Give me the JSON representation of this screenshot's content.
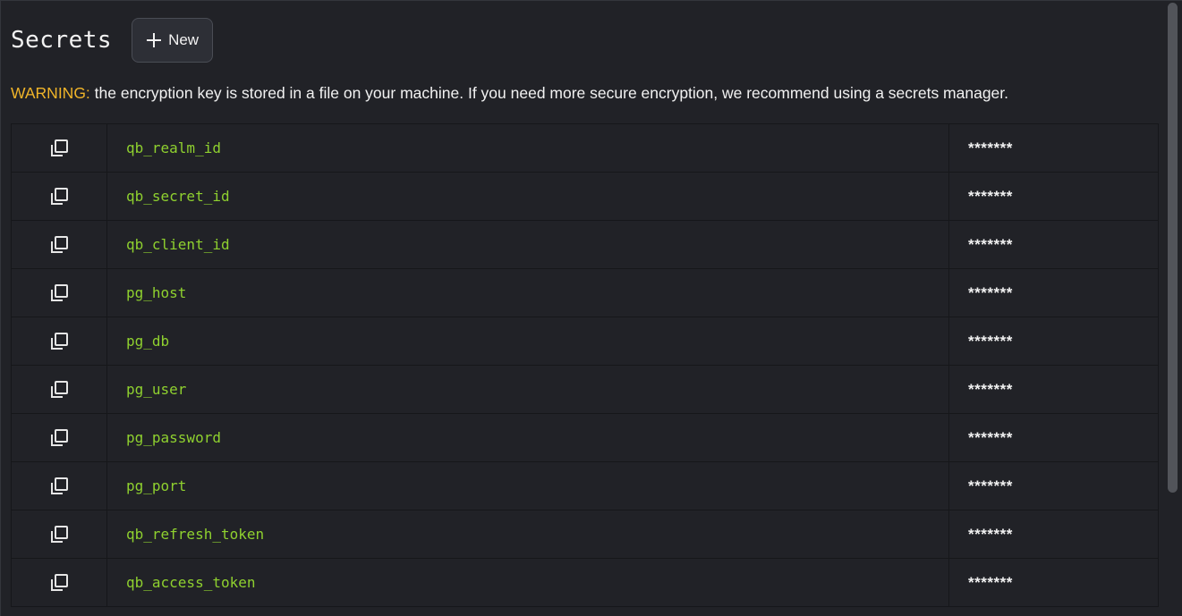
{
  "header": {
    "title": "Secrets",
    "new_button_label": "New"
  },
  "warning": {
    "label": "WARNING:",
    "text": " the encryption key is stored in a file on your machine. If you need more secure encryption, we recommend using a secrets manager."
  },
  "secrets": [
    {
      "name": "qb_realm_id",
      "value": "*******"
    },
    {
      "name": "qb_secret_id",
      "value": "*******"
    },
    {
      "name": "qb_client_id",
      "value": "*******"
    },
    {
      "name": "pg_host",
      "value": "*******"
    },
    {
      "name": "pg_db",
      "value": "*******"
    },
    {
      "name": "pg_user",
      "value": "*******"
    },
    {
      "name": "pg_password",
      "value": "*******"
    },
    {
      "name": "pg_port",
      "value": "*******"
    },
    {
      "name": "qb_refresh_token",
      "value": "*******"
    },
    {
      "name": "qb_access_token",
      "value": "*******"
    }
  ],
  "icons": {
    "new_button": "plus-icon",
    "row_action": "copy-icon"
  },
  "colors": {
    "warning": "#f0b429",
    "secret_name": "#8fd12f",
    "background": "#212227"
  }
}
